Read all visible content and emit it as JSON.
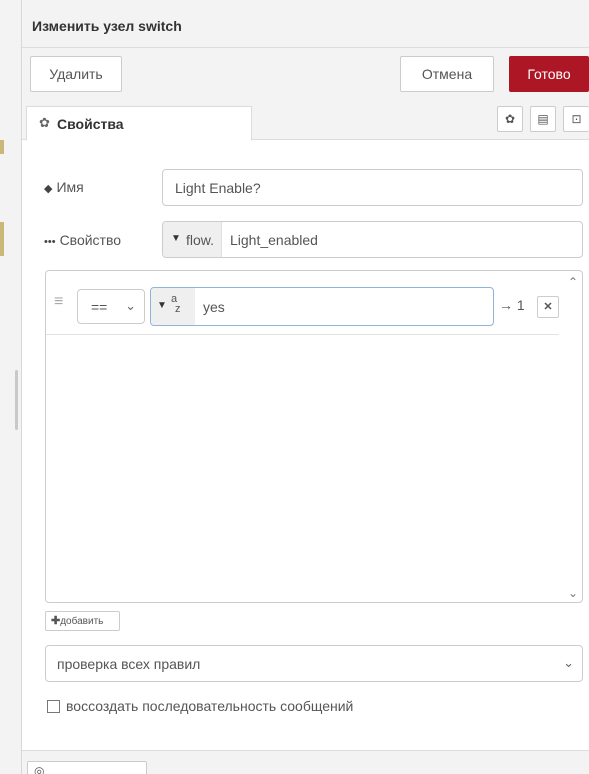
{
  "header": {
    "title": "Изменить узел switch"
  },
  "toolbar": {
    "delete_label": "Удалить",
    "cancel_label": "Отмена",
    "done_label": "Готово",
    "done_color": "#ad1625"
  },
  "tabs": {
    "properties_label": "Свойства"
  },
  "form": {
    "name_label": "Имя",
    "name_value": "Light Enable?",
    "property_label": "Свойство",
    "property_type": "flow.",
    "property_value": "Light_enabled"
  },
  "rules": [
    {
      "operator": "==",
      "value_type_a": "a",
      "value_type_z": "z",
      "value": "yes",
      "output": "→ 1"
    }
  ],
  "add_label": "добавить",
  "check_mode": "проверка всех правил",
  "recreate_label": "воссоздать последовательность сообщений"
}
